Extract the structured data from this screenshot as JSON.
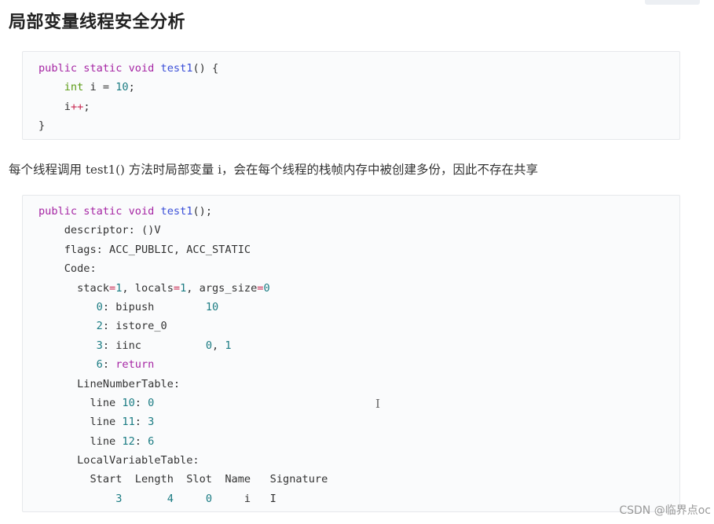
{
  "title": "局部变量线程安全分析",
  "code1": {
    "l1": {
      "a": "public",
      "b": "static",
      "c": "void",
      "d": "test1",
      "e": "() {"
    },
    "l2": {
      "a": "int",
      "b": " i = ",
      "c": "10",
      "d": ";"
    },
    "l3": {
      "a": "i",
      "b": "++",
      "c": ";"
    },
    "l4": {
      "a": "}"
    }
  },
  "prose": {
    "before": "每个线程调用 ",
    "method": "test1()",
    "middle": " 方法时局部变量 ",
    "var": "i",
    "after": "，会在每个线程的栈帧内存中被创建多份，因此不存在共享"
  },
  "code2": {
    "l1": {
      "a": "public",
      "b": "static",
      "c": "void",
      "d": "test1",
      "e": "();"
    },
    "l2": {
      "a": "descriptor: ()V"
    },
    "l3": {
      "a": "flags: ACC_PUBLIC, ACC_STATIC"
    },
    "l4": {
      "a": "Code:"
    },
    "l5": {
      "a": "stack",
      "b": "=",
      "c": "1",
      "d": ", locals",
      "e": "=",
      "f": "1",
      "g": ", args_size",
      "h": "=",
      "i": "0"
    },
    "l6": {
      "a": "0",
      "b": ": bipush        ",
      "c": "10"
    },
    "l7": {
      "a": "2",
      "b": ": istore_0"
    },
    "l8": {
      "a": "3",
      "b": ": iinc          ",
      "c": "0",
      "d": ", ",
      "e": "1"
    },
    "l9": {
      "a": "6",
      "b": ": ",
      "c": "return"
    },
    "l10": {
      "a": "LineNumberTable:"
    },
    "l11": {
      "a": "line ",
      "b": "10",
      "c": ": ",
      "d": "0"
    },
    "l12": {
      "a": "line ",
      "b": "11",
      "c": ": ",
      "d": "3"
    },
    "l13": {
      "a": "line ",
      "b": "12",
      "c": ": ",
      "d": "6"
    },
    "l14": {
      "a": "LocalVariableTable:"
    },
    "l15": {
      "a": "Start  Length  Slot  Name   Signature"
    },
    "l16": {
      "a": "3",
      "b": "       ",
      "c": "4",
      "d": "     ",
      "e": "0",
      "f": "     i   I"
    }
  },
  "cursor_glyph": "I",
  "watermark": "CSDN @临界点oc"
}
